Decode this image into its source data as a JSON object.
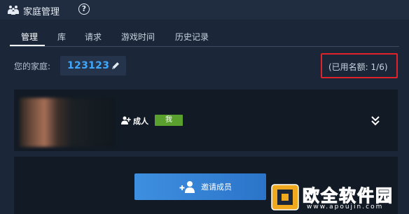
{
  "header": {
    "title": "家庭管理",
    "help_icon": "question-circle-icon",
    "help_glyph": "?"
  },
  "tabs": [
    {
      "label": "管理",
      "active": true
    },
    {
      "label": "库",
      "active": false
    },
    {
      "label": "请求",
      "active": false
    },
    {
      "label": "游戏时间",
      "active": false
    },
    {
      "label": "历史记录",
      "active": false
    }
  ],
  "family": {
    "label": "您的家庭:",
    "id": "123123",
    "edit_icon": "pencil-icon"
  },
  "quota": {
    "text": "(已用名额: 1/6)",
    "highlight_color": "#e0232b"
  },
  "member": {
    "role": "成人",
    "badge": "我",
    "badge_color": "#59a02e",
    "expand_icon": "double-chevron-down-icon"
  },
  "invite": {
    "label": "邀请成员",
    "icon": "add-user-icon"
  },
  "watermark": {
    "name": "欧全软件园",
    "url": "www.apoujin.com"
  },
  "colors": {
    "background": "#1b2638",
    "accent": "#3fa8ff",
    "button": "#3e8fe0"
  }
}
